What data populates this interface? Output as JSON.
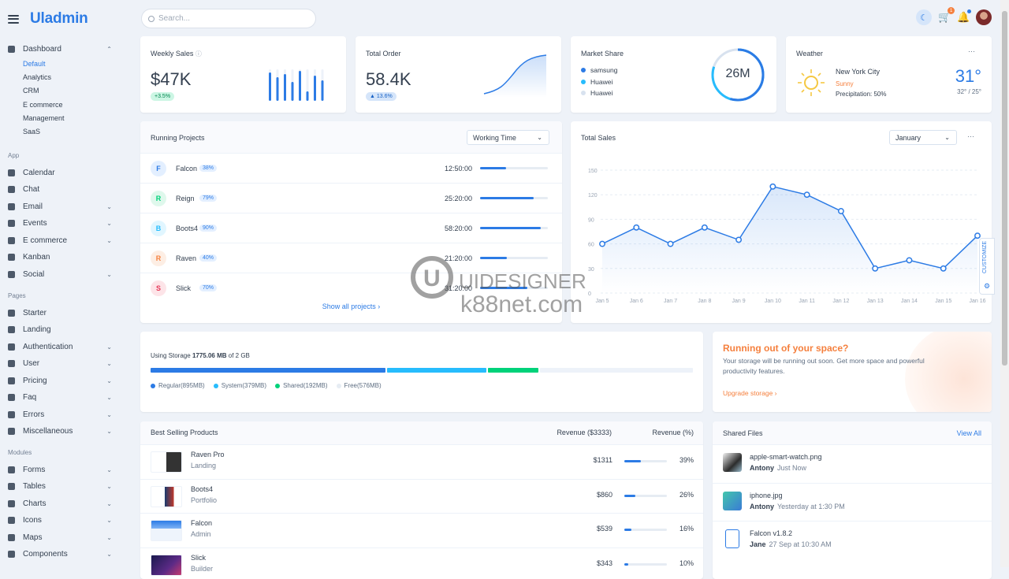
{
  "brand": {
    "name": "Uladmin"
  },
  "search": {
    "placeholder": "Search..."
  },
  "topbar": {
    "cart_count": "1"
  },
  "sidebar": {
    "dashboard": "Dashboard",
    "dashboard_sub": [
      "Default",
      "Analytics",
      "CRM",
      "E commerce",
      "Management",
      "SaaS"
    ],
    "app_label": "App",
    "app": [
      "Calendar",
      "Chat",
      "Email",
      "Events",
      "E commerce",
      "Kanban",
      "Social"
    ],
    "pages_label": "Pages",
    "pages": [
      "Starter",
      "Landing",
      "Authentication",
      "User",
      "Pricing",
      "Faq",
      "Errors",
      "Miscellaneous"
    ],
    "modules_label": "Modules",
    "modules": [
      "Forms",
      "Tables",
      "Charts",
      "Icons",
      "Maps",
      "Components"
    ]
  },
  "weekly_sales": {
    "title": "Weekly Sales",
    "value": "$47K",
    "change": "+3.5%"
  },
  "total_order": {
    "title": "Total Order",
    "value": "58.4K",
    "change": "▲ 13.6%"
  },
  "market_share": {
    "title": "Market Share",
    "center": "26M",
    "legend": [
      "samsung",
      "Huawei",
      "Huawei"
    ],
    "colors": [
      "#2c7be5",
      "#27bcfd",
      "#d8e2ef"
    ]
  },
  "weather": {
    "title": "Weather",
    "city": "New York City",
    "condition": "Sunny",
    "precip": "Precipitation: 50%",
    "temp": "31°",
    "range": "32° / 25°",
    "menu": "···"
  },
  "projects": {
    "title": "Running Projects",
    "select": "Working Time",
    "show_all": "Show all projects ›",
    "rows": [
      {
        "letter": "F",
        "name": "Falcon",
        "pct": "38%",
        "time": "12:50:00",
        "fill": 0.38,
        "color": "#2c7be5",
        "bg": "#e3efff"
      },
      {
        "letter": "R",
        "name": "Reign",
        "pct": "79%",
        "time": "25:20:00",
        "fill": 0.79,
        "color": "#00d27a",
        "bg": "#dff8ec"
      },
      {
        "letter": "B",
        "name": "Boots4",
        "pct": "90%",
        "time": "58:20:00",
        "fill": 0.9,
        "color": "#27bcfd",
        "bg": "#e1f6ff"
      },
      {
        "letter": "R",
        "name": "Raven",
        "pct": "40%",
        "time": "21:20:00",
        "fill": 0.4,
        "color": "#f5803e",
        "bg": "#fdeee4"
      },
      {
        "letter": "S",
        "name": "Slick",
        "pct": "70%",
        "time": "31:20:00",
        "fill": 0.7,
        "color": "#e63757",
        "bg": "#fde4e8"
      }
    ]
  },
  "total_sales": {
    "title": "Total Sales",
    "select": "January",
    "menu": "···"
  },
  "chart_data": {
    "type": "line",
    "title": "Total Sales",
    "x": [
      "Jan 5",
      "Jan 6",
      "Jan 7",
      "Jan 8",
      "Jan 9",
      "Jan 10",
      "Jan 11",
      "Jan 12",
      "Jan 13",
      "Jan 14",
      "Jan 15",
      "Jan 16"
    ],
    "values": [
      60,
      80,
      60,
      80,
      65,
      130,
      120,
      100,
      30,
      40,
      30,
      70
    ],
    "yticks": [
      0,
      30,
      60,
      90,
      120,
      150
    ],
    "ylim": [
      0,
      150
    ],
    "grid": true
  },
  "storage": {
    "label": "Using Storage",
    "used": "1775.06 MB",
    "of": "of 2 GB",
    "segments": [
      {
        "name": "Regular(895MB)",
        "frac": 0.437,
        "color": "#2c7be5"
      },
      {
        "name": "System(379MB)",
        "frac": 0.185,
        "color": "#27bcfd"
      },
      {
        "name": "Shared(192MB)",
        "frac": 0.094,
        "color": "#00d27a"
      },
      {
        "name": "Free(576MB)",
        "frac": 0.284,
        "color": "#edf2f9"
      }
    ]
  },
  "space": {
    "title": "Running out of your space?",
    "text": "Your storage will be running out soon. Get more space and powerful productivity features.",
    "link": "Upgrade storage ›"
  },
  "products": {
    "title": "Best Selling Products",
    "col1": "Revenue ($3333)",
    "col2": "Revenue (%)",
    "rows": [
      {
        "name": "Raven Pro",
        "cat": "Landing",
        "rev": "$1311",
        "pct": "39%",
        "fill": 0.39
      },
      {
        "name": "Boots4",
        "cat": "Portfolio",
        "rev": "$860",
        "pct": "26%",
        "fill": 0.26
      },
      {
        "name": "Falcon",
        "cat": "Admin",
        "rev": "$539",
        "pct": "16%",
        "fill": 0.16
      },
      {
        "name": "Slick",
        "cat": "Builder",
        "rev": "$343",
        "pct": "10%",
        "fill": 0.1
      }
    ]
  },
  "files": {
    "title": "Shared Files",
    "view_all": "View All",
    "rows": [
      {
        "name": "apple-smart-watch.png",
        "user": "Antony",
        "time": "Just Now"
      },
      {
        "name": "iphone.jpg",
        "user": "Antony",
        "time": "Yesterday at 1:30 PM"
      },
      {
        "name": "Falcon v1.8.2",
        "user": "Jane",
        "time": "27 Sep at 10:30 AM"
      }
    ]
  },
  "customize": "CUSTOMIZE",
  "watermark": {
    "line1": "UIDESIGNER",
    "line2": "k88net.com"
  }
}
